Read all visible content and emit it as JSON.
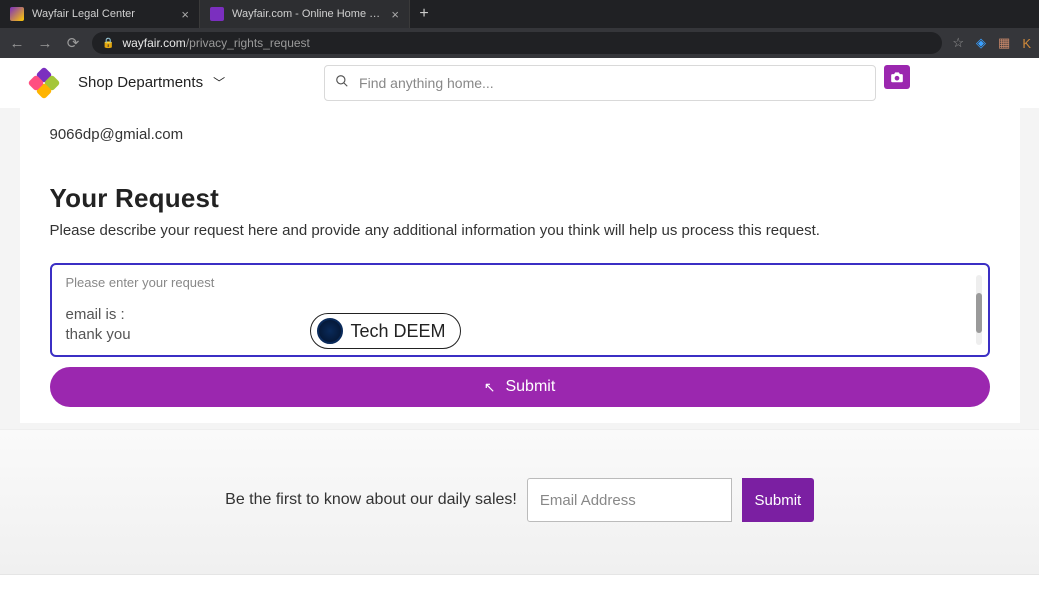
{
  "browser": {
    "tabs": [
      {
        "title": "Wayfair Legal Center",
        "active": false
      },
      {
        "title": "Wayfair.com - Online Home Store",
        "active": true
      }
    ],
    "url_domain": "wayfair.com",
    "url_path": "/privacy_rights_request",
    "profile_initial": "K"
  },
  "header": {
    "shop_label": "Shop Departments",
    "search_placeholder": "Find anything home..."
  },
  "form": {
    "email_shown": "9066dp@gmial.com",
    "section_title": "Your Request",
    "section_desc": "Please describe your request here and provide any additional information you think will help us process this request.",
    "textarea_placeholder": "Please enter your request",
    "entered_line1": "email is :",
    "entered_line2": "thank you",
    "submit_label": "Submit"
  },
  "overlay": {
    "label": "Tech DEEM"
  },
  "footer": {
    "cta_text": "Be the first to know about our daily sales!",
    "email_placeholder": "Email Address",
    "submit_label": "Submit"
  }
}
